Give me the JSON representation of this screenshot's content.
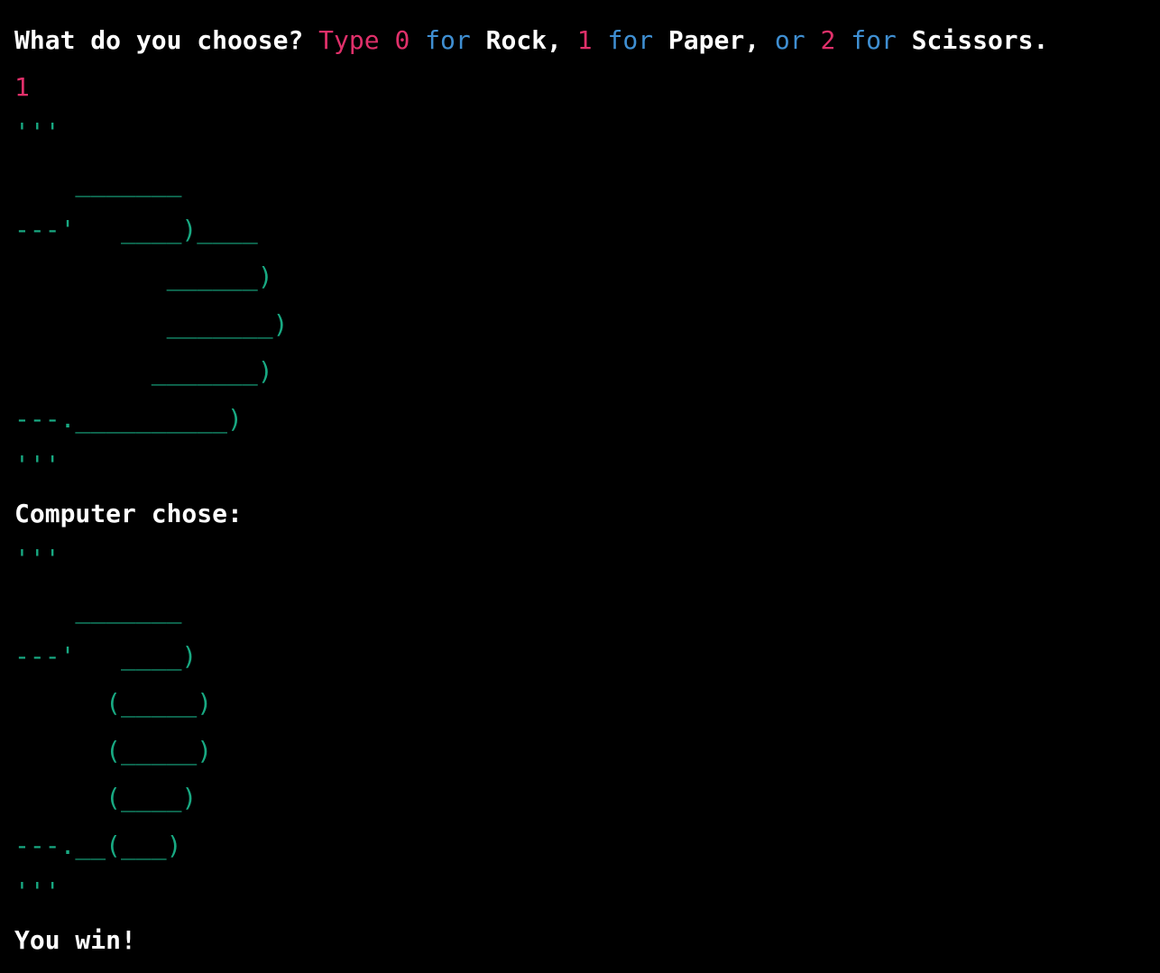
{
  "colors": {
    "background": "#000000",
    "text": "#ffffff",
    "string_literal": "#e0306a",
    "keyword": "#3f8fd2",
    "ascii_art": "#18a982"
  },
  "prompt": {
    "part1": "What do you choose? ",
    "part2": "Type 0 ",
    "part3": "for",
    "part4": " Rock, ",
    "part5": "1 ",
    "part6": "for",
    "part7": " Paper, ",
    "part8": "or",
    "part9": " 2 ",
    "part10": "for",
    "part11": " Scissors."
  },
  "user_input": "1",
  "user_choice_art": [
    "'''",
    "    _______",
    "---'   ____)____",
    "          ______)",
    "          _______)",
    "         _______)",
    "---.__________)",
    "'''"
  ],
  "computer_label": "Computer chose:",
  "computer_choice_art": [
    "'''",
    "    _______",
    "---'   ____)",
    "      (_____)",
    "      (_____)",
    "      (____)",
    "---.__(___)",
    "'''"
  ],
  "result": "You win!"
}
